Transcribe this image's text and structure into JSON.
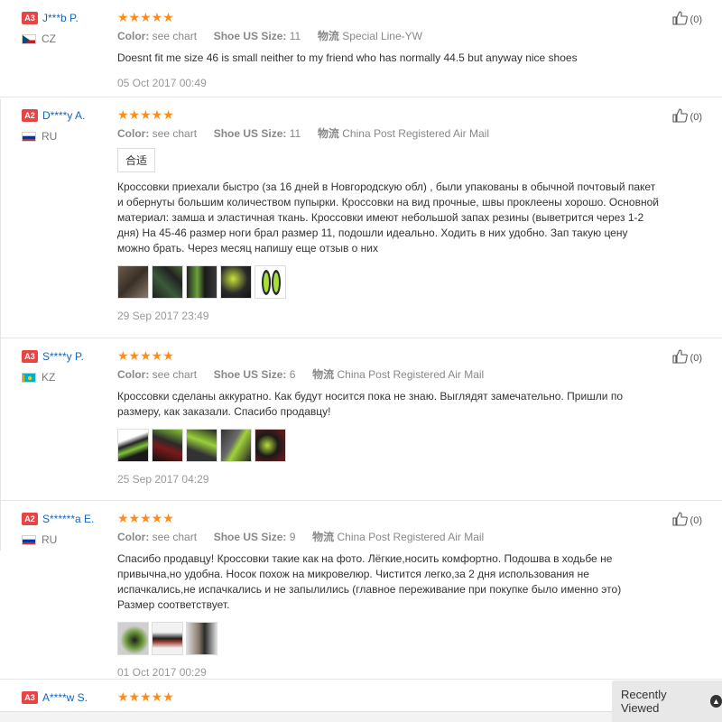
{
  "reviews": [
    {
      "level": "A3",
      "name": "J***b P.",
      "country": "CZ",
      "stars": "★★★★★",
      "color_label": "Color:",
      "color_value": "see chart",
      "size_label": "Shoe US Size:",
      "size_value": "11",
      "logistics_label": "物流",
      "logistics_value": "Special Line-YW",
      "text": "Doesnt fit me size 46 is small neither to my friend who has normally 44.5 but anyway nice shoes",
      "date": "05 Oct 2017 00:49",
      "helpful": "(0)"
    },
    {
      "level": "A2",
      "name": "D****y A.",
      "country": "RU",
      "stars": "★★★★★",
      "color_label": "Color:",
      "color_value": "see chart",
      "size_label": "Shoe US Size:",
      "size_value": "11",
      "logistics_label": "物流",
      "logistics_value": "China Post Registered Air Mail",
      "translate_label": "合适",
      "text": "Кроссовки приехали быстро (за 16 дней в Новгородскую обл) , были упакованы в обычной почтовый пакет и обернуты большим количеством пупырки. Кроссовки на вид прочные, швы проклеены хорошо. Основной материал: замша и эластичная ткань. Кроссовки имеют небольшой запах резины (выветрится через 1-2 дня) На 45-46 размер ноги брал размер 11, подошли идеально. Ходить в них удобно. Зап такую цену можно брать. Через месяц напишу еще отзыв о них",
      "date": "29 Sep 2017 23:49",
      "helpful": "(0)"
    },
    {
      "level": "A3",
      "name": "S****y P.",
      "country": "KZ",
      "stars": "★★★★★",
      "color_label": "Color:",
      "color_value": "see chart",
      "size_label": "Shoe US Size:",
      "size_value": "6",
      "logistics_label": "物流",
      "logistics_value": "China Post Registered Air Mail",
      "text": "Кроссовки сделаны аккуратно. Как будут носится пока не знаю. Выглядят замечательно. Пришли по размеру, как заказали. Спасибо продавцу!",
      "date": "25 Sep 2017 04:29",
      "helpful": "(0)"
    },
    {
      "level": "A2",
      "name": "S******a E.",
      "country": "RU",
      "stars": "★★★★★",
      "color_label": "Color:",
      "color_value": "see chart",
      "size_label": "Shoe US Size:",
      "size_value": "9",
      "logistics_label": "物流",
      "logistics_value": "China Post Registered Air Mail",
      "text": "Спасибо продавцу! Кроссовки такие как на фото. Лёгкие,носить комфортно. Подошва в ходьбе не привычна,но удобна. Носок похож на микровелюр. Чистится легко,за 2 дня использования не испачкались,не испачкались и не запылились (главное переживание при покупке было именно это) Размер соответствует.",
      "date": "01 Oct 2017 00:29",
      "helpful": "(0)"
    },
    {
      "level": "A3",
      "name": "A****w S.",
      "stars": "★★★★★"
    }
  ],
  "recently_viewed": "Recently Viewed",
  "colors": {
    "star": "#ff8c1a",
    "level_badge": "#e64545",
    "name": "#1565c0"
  }
}
